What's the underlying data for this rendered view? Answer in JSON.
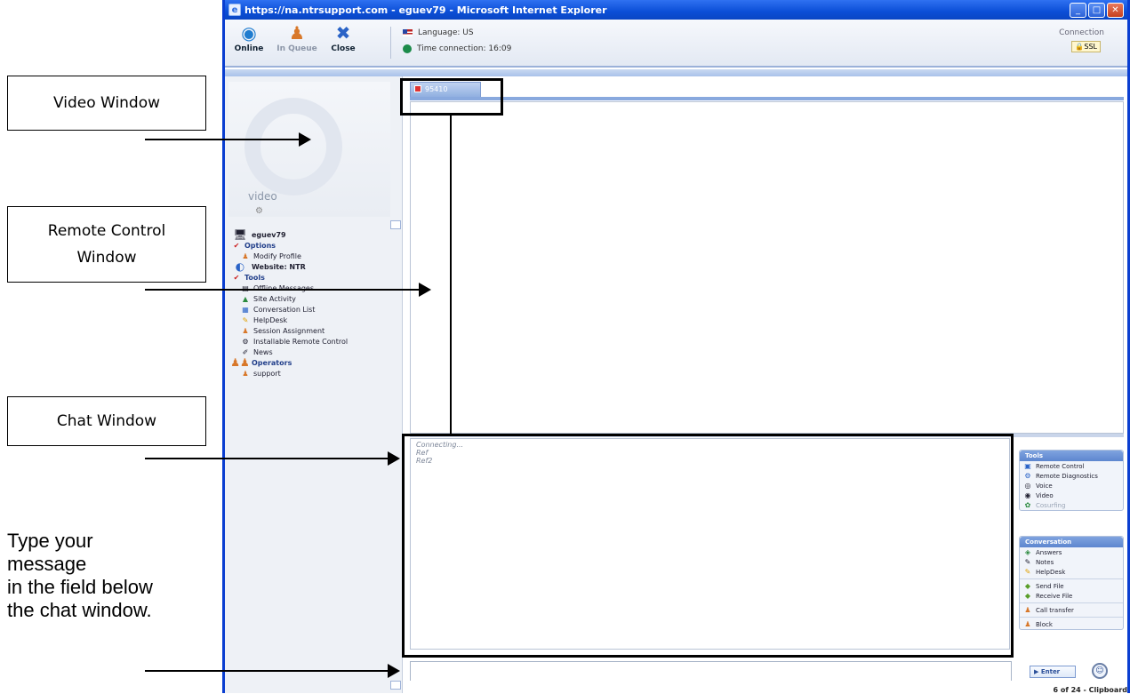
{
  "window": {
    "title": "https://na.ntrsupport.com - eguev79 - Microsoft Internet Explorer",
    "accent": "#0b4ed6"
  },
  "toolbar": {
    "buttons": [
      {
        "label": "Online",
        "icon": "globe-online-icon"
      },
      {
        "label": "In Queue",
        "icon": "user-queue-icon"
      },
      {
        "label": "Close",
        "icon": "close-x-icon"
      }
    ],
    "language": "Language: US",
    "time_connection": "Time connection: 16:09",
    "connection_label": "Connection",
    "ssl_label": "SSL"
  },
  "video": {
    "label": "video"
  },
  "tree": {
    "user": "eguev79",
    "options": "Options",
    "modify_profile": "Modify Profile",
    "website": "Website: NTR",
    "tools": "Tools",
    "tool_items": [
      "Offline Messages",
      "Site Activity",
      "Conversation List",
      "HelpDesk",
      "Session Assignment",
      "Installable Remote Control",
      "News"
    ],
    "operators": "Operators",
    "operator_items": [
      "support"
    ]
  },
  "session_tab": {
    "label": "95410"
  },
  "chat": {
    "lines": [
      "Connecting...",
      "Ref",
      "Ref2"
    ]
  },
  "right_panel": {
    "tools_header": "Tools",
    "tools": [
      "Remote Control",
      "Remote Diagnostics",
      "Voice",
      "Video",
      "Cosurfing"
    ],
    "conversation_header": "Conversation",
    "conversation": [
      "Answers",
      "Notes",
      "HelpDesk"
    ],
    "file_items": [
      "Send File",
      "Receive File"
    ],
    "call_transfer": "Call transfer",
    "block": "Block"
  },
  "input": {
    "enter_label": "Enter",
    "footer": "6 of 24 - Clipboard"
  },
  "annotations": {
    "video_window": "Video Window",
    "remote_control_line1": "Remote Control",
    "remote_control_line2": "Window",
    "chat_window": "Chat Window",
    "type_note_line1": "Type your",
    "type_note_line2": "message",
    "type_note_line3": "in the field below",
    "type_note_line4": "the chat window."
  }
}
